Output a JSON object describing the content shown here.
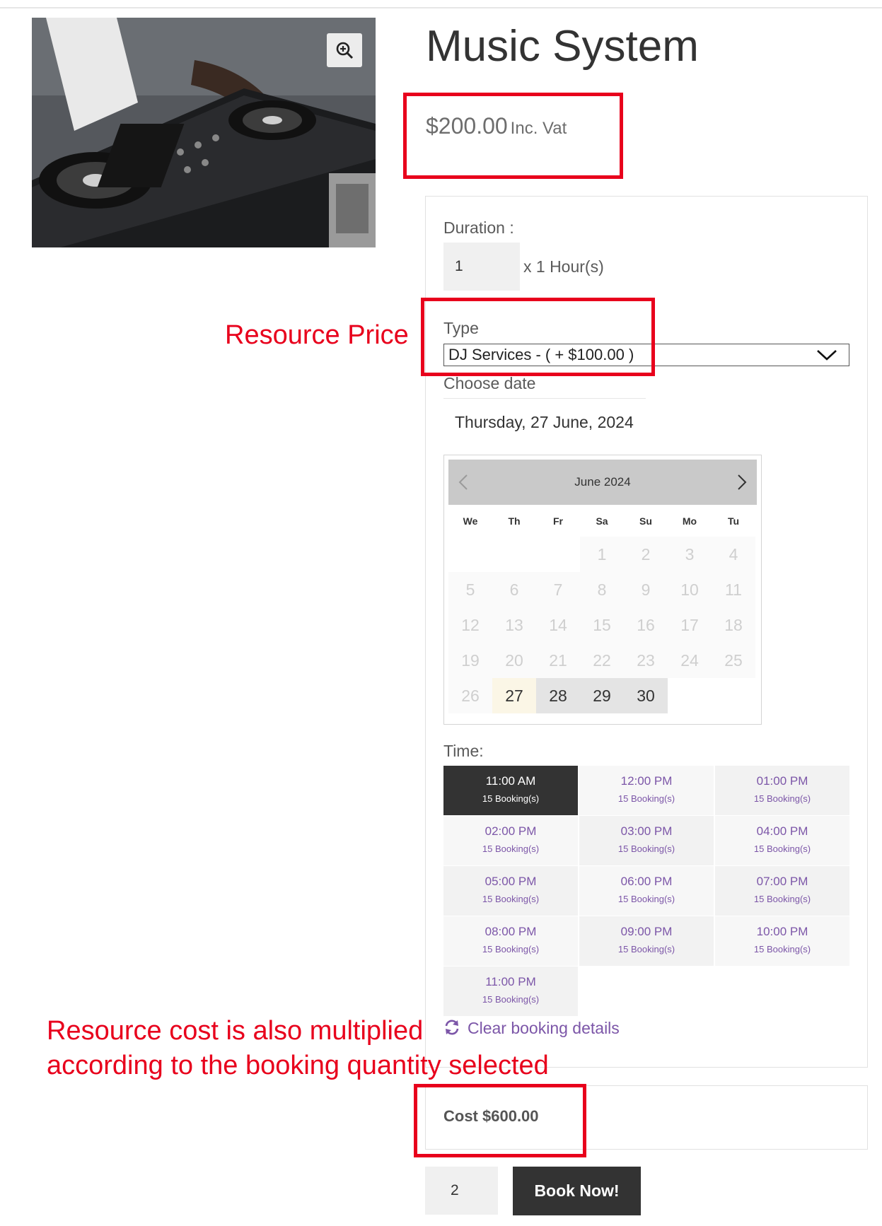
{
  "product": {
    "title": "Music System",
    "price": "$200.00",
    "price_suffix": "Inc. Vat"
  },
  "form": {
    "duration_label": "Duration :",
    "duration_value": "1",
    "duration_unit": "x 1 Hour(s)",
    "type_label": "Type",
    "type_selected": "DJ Services - ( + $100.00 )",
    "date_label": "Choose date",
    "date_value": "Thursday, 27 June, 2024"
  },
  "calendar": {
    "month": "June 2024",
    "weekdays": [
      "We",
      "Th",
      "Fr",
      "Sa",
      "Su",
      "Mo",
      "Tu"
    ],
    "disabled_days": [
      "1",
      "2",
      "3",
      "4",
      "5",
      "6",
      "7",
      "8",
      "9",
      "10",
      "11",
      "12",
      "13",
      "14",
      "15",
      "16",
      "17",
      "18",
      "19",
      "20",
      "21",
      "22",
      "23",
      "24",
      "25",
      "26"
    ],
    "selected_day": "27",
    "available_days": [
      "28",
      "29",
      "30"
    ]
  },
  "time": {
    "label": "Time:",
    "slots": [
      {
        "time": "11:00 AM",
        "bookings": "15 Booking(s)"
      },
      {
        "time": "12:00 PM",
        "bookings": "15 Booking(s)"
      },
      {
        "time": "01:00 PM",
        "bookings": "15 Booking(s)"
      },
      {
        "time": "02:00 PM",
        "bookings": "15 Booking(s)"
      },
      {
        "time": "03:00 PM",
        "bookings": "15 Booking(s)"
      },
      {
        "time": "04:00 PM",
        "bookings": "15 Booking(s)"
      },
      {
        "time": "05:00 PM",
        "bookings": "15 Booking(s)"
      },
      {
        "time": "06:00 PM",
        "bookings": "15 Booking(s)"
      },
      {
        "time": "07:00 PM",
        "bookings": "15 Booking(s)"
      },
      {
        "time": "08:00 PM",
        "bookings": "15 Booking(s)"
      },
      {
        "time": "09:00 PM",
        "bookings": "15 Booking(s)"
      },
      {
        "time": "10:00 PM",
        "bookings": "15 Booking(s)"
      },
      {
        "time": "11:00 PM",
        "bookings": "15 Booking(s)"
      }
    ]
  },
  "actions": {
    "clear_label": "Clear booking details",
    "cost": "Cost $600.00",
    "quantity": "2",
    "book_label": "Book Now!"
  },
  "annotations": {
    "resource_price": "Resource Price",
    "note_line1": "Resource cost is also multiplied",
    "note_line2": "according to the booking quantity selected"
  },
  "colors": {
    "annotation_red": "#e8001c",
    "accent_purple": "#7c56a8",
    "dark_button": "#333333"
  }
}
